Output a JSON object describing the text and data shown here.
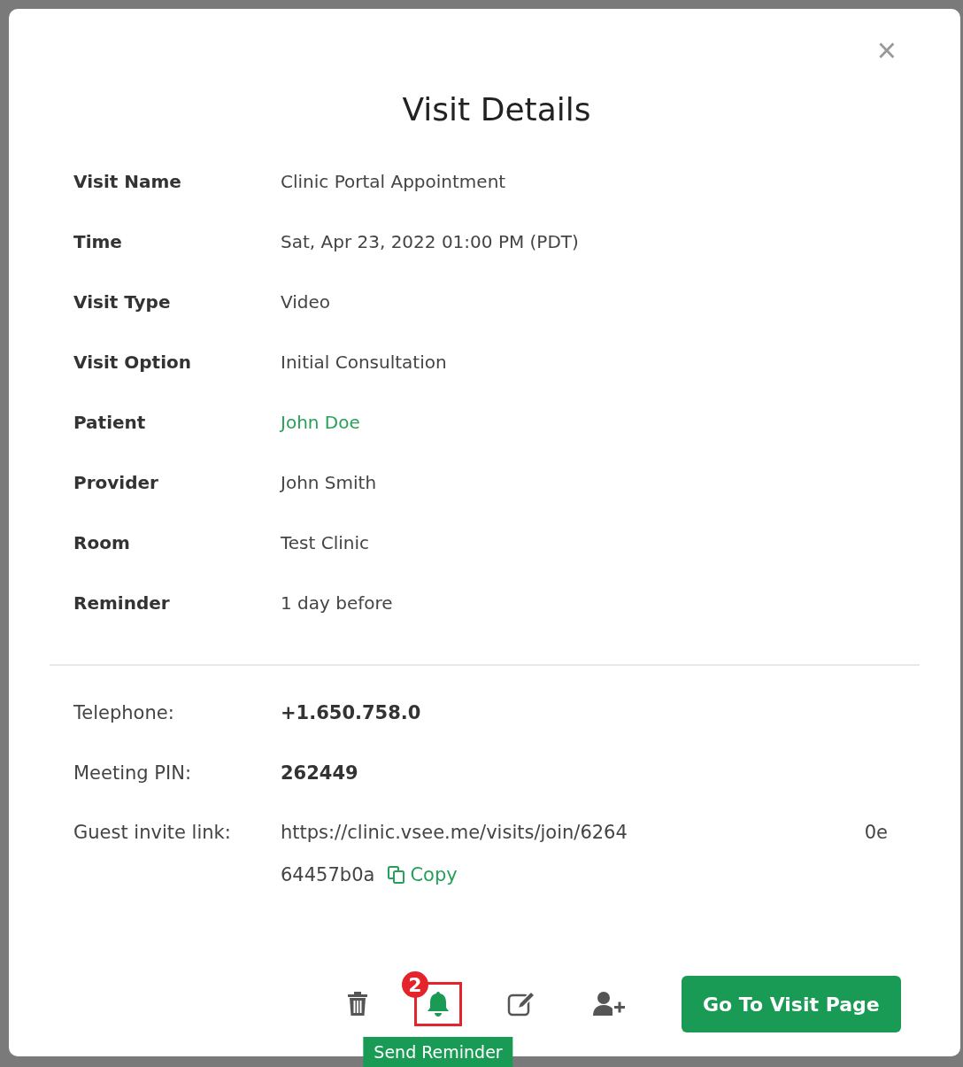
{
  "dialog": {
    "title": "Visit Details",
    "close": "×"
  },
  "details": [
    {
      "label": "Visit Name",
      "value": "Clinic Portal Appointment",
      "kind": "text"
    },
    {
      "label": "Time",
      "value": "Sat, Apr 23, 2022 01:00 PM (PDT)",
      "kind": "text"
    },
    {
      "label": "Visit Type",
      "value": "Video",
      "kind": "text"
    },
    {
      "label": "Visit Option",
      "value": "Initial Consultation",
      "kind": "text"
    },
    {
      "label": "Patient",
      "value": "John Doe",
      "kind": "link"
    },
    {
      "label": "Provider",
      "value": "John Smith",
      "kind": "text"
    },
    {
      "label": "Room",
      "value": "Test Clinic",
      "kind": "text"
    },
    {
      "label": "Reminder",
      "value": "1 day before",
      "kind": "text"
    }
  ],
  "contact": {
    "telephone": {
      "label": "Telephone:",
      "value": "+1.650.758.0"
    },
    "pin": {
      "label": "Meeting PIN:",
      "value": "262449"
    },
    "invite": {
      "label": "Guest invite link:",
      "value_start": "https://clinic.vsee.me/visits/join/6264",
      "value_end": "0e",
      "value_line2": "64457b0a",
      "copy": "Copy"
    }
  },
  "actions": [
    {
      "kind": "trash",
      "highlighted": false
    },
    {
      "kind": "bell",
      "highlighted": true,
      "step": "2",
      "tooltip": "Send Reminder"
    },
    {
      "kind": "edit",
      "highlighted": false
    },
    {
      "kind": "add-user",
      "highlighted": false
    }
  ],
  "primary_button": "Go To Visit Page"
}
